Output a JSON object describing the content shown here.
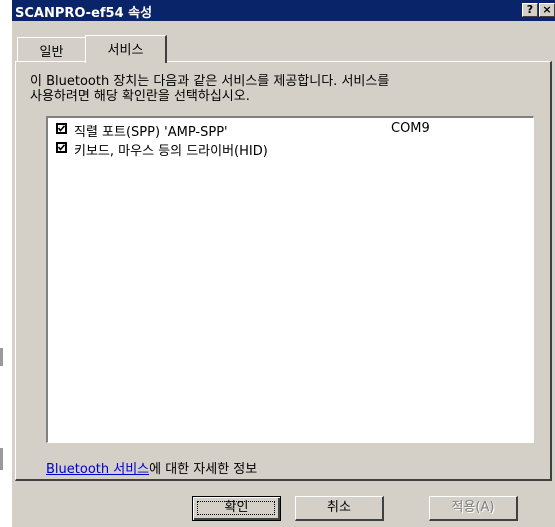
{
  "window": {
    "title": "SCANPRO-ef54 속성",
    "help_button": "?",
    "close_button": "×"
  },
  "tabs": [
    {
      "label": "일반",
      "active": false
    },
    {
      "label": "서비스",
      "active": true
    }
  ],
  "services_page": {
    "description_line1": "이 Bluetooth 장치는 다음과 같은 서비스를 제공합니다. 서비스를",
    "description_line2": "사용하려면 해당 확인란을 선택하십시오.",
    "services": [
      {
        "name": "직렬 포트(SPP) 'AMP-SPP'",
        "port": "COM9",
        "checked": true
      },
      {
        "name": "키보드, 마우스 등의 드라이버(HID)",
        "port": "",
        "checked": true
      }
    ],
    "info_link": "Bluetooth 서비스",
    "info_suffix": "에 대한 자세한 정보"
  },
  "buttons": {
    "ok": "확인",
    "cancel": "취소",
    "apply": "적용(A)"
  },
  "colors": {
    "titlebar": "#0a246a",
    "dialog_face": "#d4d0c8",
    "link": "#0000cc"
  }
}
